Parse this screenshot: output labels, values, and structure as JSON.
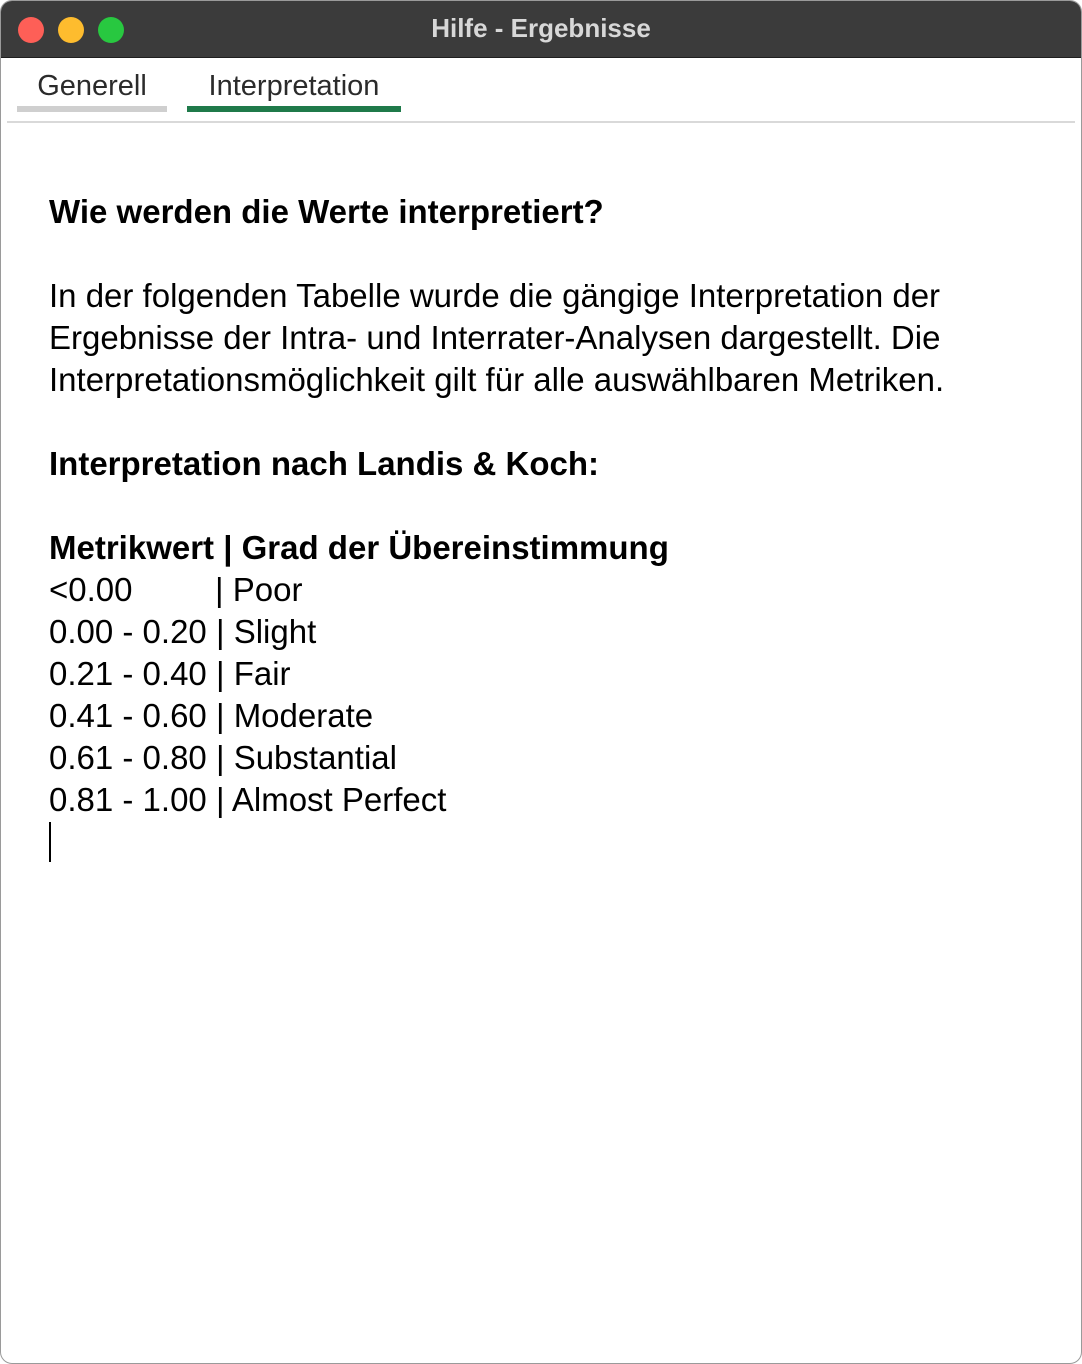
{
  "window": {
    "title": "Hilfe - Ergebnisse",
    "colors": {
      "titlebar": "#3b3b3b",
      "close": "#fe5f57",
      "minimize": "#febc2e",
      "zoom": "#28c840",
      "active_tab_underline": "#1f7a4a"
    }
  },
  "tabs": [
    {
      "label": "Generell",
      "active": false
    },
    {
      "label": "Interpretation",
      "active": true
    }
  ],
  "content": {
    "heading": "Wie werden die Werte interpretiert?",
    "paragraph_lines": [
      "In der folgenden Tabelle wurde die gängige Interpretation der",
      "Ergebnisse der Intra- und Interrater-Analysen dargestellt. Die",
      "Interpretationsmöglichkeit gilt für alle auswählbaren Metriken."
    ],
    "subheading": "Interpretation nach Landis & Koch:",
    "table_header": "Metrikwert | Grad der Übereinstimmung",
    "table_rows": [
      "<0.00         | Poor",
      "0.00 - 0.20 | Slight",
      "0.21 - 0.40 | Fair",
      "0.41 - 0.60 | Moderate",
      "0.61 - 0.80 | Substantial",
      "0.81 - 1.00 | Almost Perfect"
    ]
  }
}
